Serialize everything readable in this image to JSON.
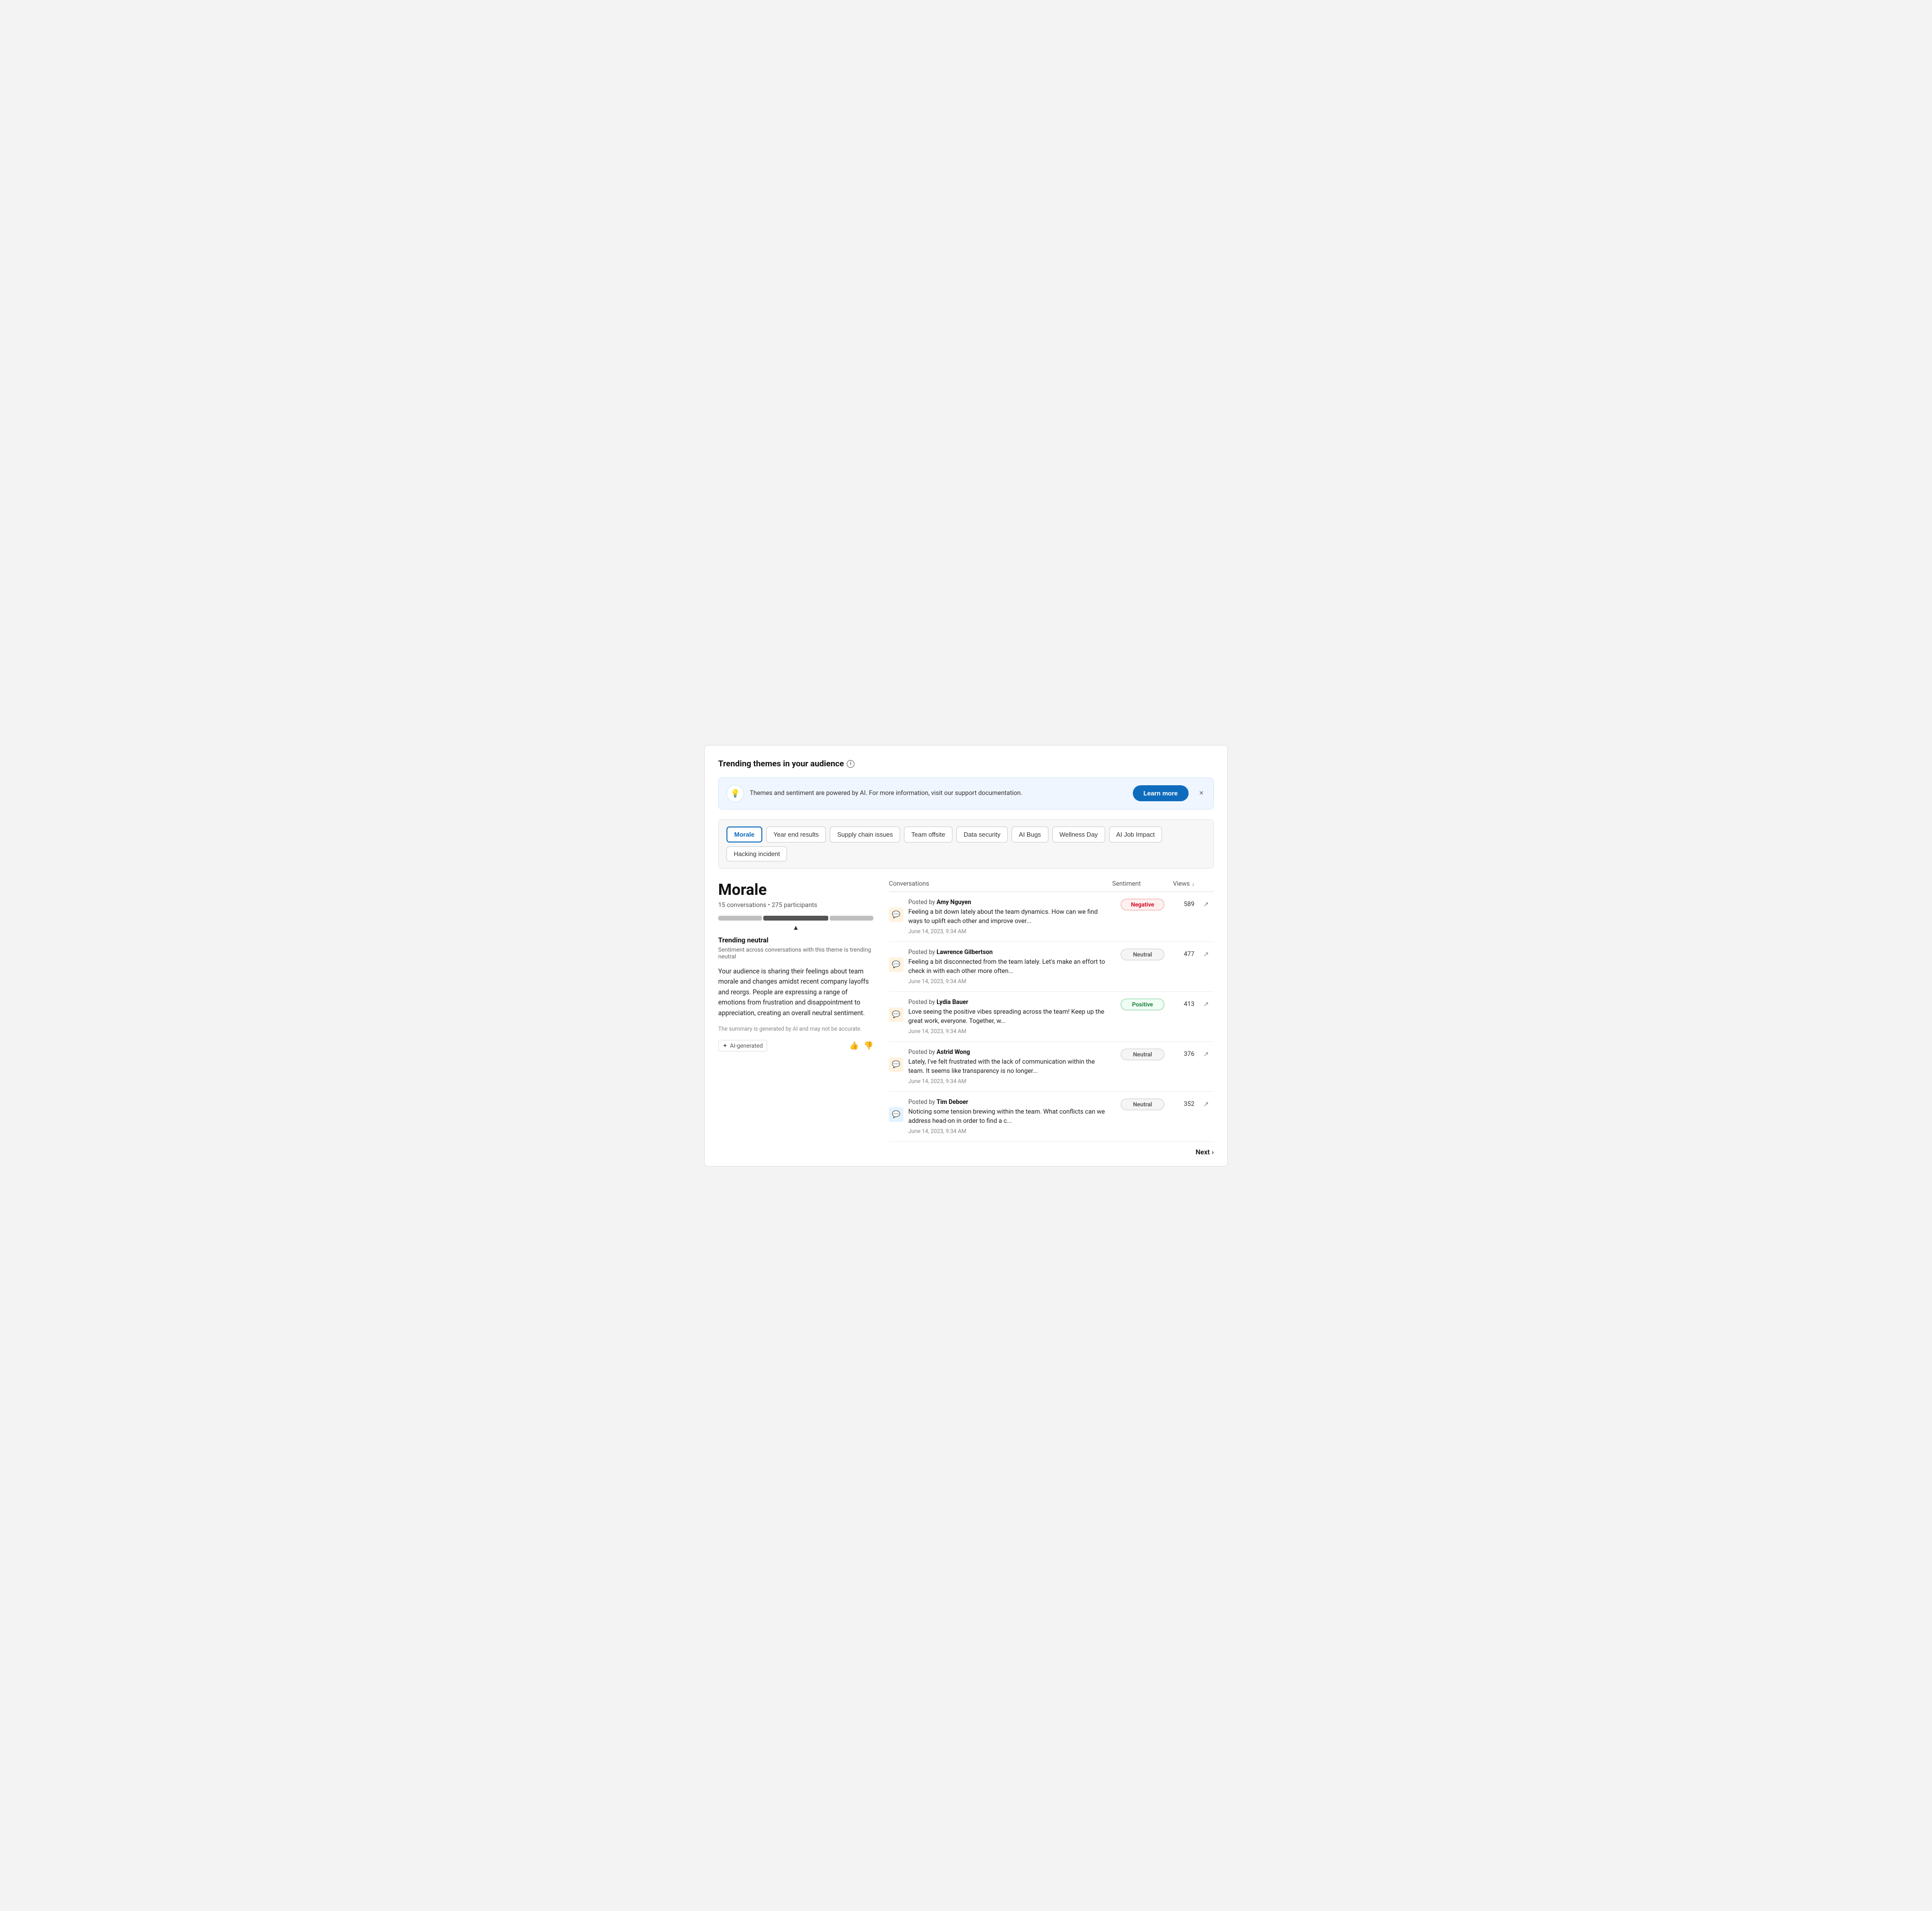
{
  "page": {
    "title": "Trending themes in your audience"
  },
  "banner": {
    "icon": "💡",
    "text": "Themes and sentiment are powered by AI. For more information, visit our support documentation.",
    "learn_more": "Learn more",
    "close_label": "×"
  },
  "themes": [
    {
      "label": "Morale",
      "active": true
    },
    {
      "label": "Year end results",
      "active": false
    },
    {
      "label": "Supply chain issues",
      "active": false
    },
    {
      "label": "Team offsite",
      "active": false
    },
    {
      "label": "Data security",
      "active": false
    },
    {
      "label": "AI Bugs",
      "active": false
    },
    {
      "label": "Wellness Day",
      "active": false
    },
    {
      "label": "AI Job Impact",
      "active": false
    },
    {
      "label": "Hacking incident",
      "active": false
    }
  ],
  "detail": {
    "title": "Morale",
    "conversations_count": "15 conversations",
    "participants_count": "275 participants",
    "trending_label": "Trending neutral",
    "trending_sub": "Sentiment across conversations with this theme is trending neutral",
    "summary": "Your audience is sharing their feelings about team morale and changes amidst recent company layoffs and reorgs. People are expressing a range of emotions from frustration and disappointment to appreciation, creating an overall neutral sentiment.",
    "ai_disclaimer": "The summary is generated by AI and may not be accurate.",
    "ai_generated_label": "AI-generated",
    "thumbs_up": "👍",
    "thumbs_down": "👎"
  },
  "table": {
    "col_conversations": "Conversations",
    "col_sentiment": "Sentiment",
    "col_views": "Views",
    "sort_arrow": "↓"
  },
  "conversations": [
    {
      "author": "Amy Nguyen",
      "text": "Feeling a bit down lately about the team dynamics. How can we find ways to uplift each other and improve over...",
      "date": "June 14, 2023, 9:34 AM",
      "sentiment": "Negative",
      "sentiment_class": "negative",
      "views": "589",
      "icon_type": "orange",
      "icon": "💬"
    },
    {
      "author": "Lawrence Gilbertson",
      "text": "Feeling a bit disconnected from the team lately. Let's make an effort to check in with each other more often...",
      "date": "June 14, 2023, 9:34 AM",
      "sentiment": "Neutral",
      "sentiment_class": "neutral",
      "views": "477",
      "icon_type": "orange",
      "icon": "💬"
    },
    {
      "author": "Lydia Bauer",
      "text": "Love seeing the positive vibes spreading across the team! Keep up the great work, everyone. Together, w...",
      "date": "June 14, 2023, 9:34 AM",
      "sentiment": "Positive",
      "sentiment_class": "positive",
      "views": "413",
      "icon_type": "orange",
      "icon": "💬"
    },
    {
      "author": "Astrid Wong",
      "text": "Lately, I've felt frustrated with the lack of communication within the team. It seems like transparency is no longer...",
      "date": "June 14, 2023, 9:34 AM",
      "sentiment": "Neutral",
      "sentiment_class": "neutral",
      "views": "376",
      "icon_type": "orange",
      "icon": "💬"
    },
    {
      "author": "Tim Deboer",
      "text": "Noticing some tension brewing within the team. What conflicts can we address head-on in order to find a c...",
      "date": "June 14, 2023, 9:34 AM",
      "sentiment": "Neutral",
      "sentiment_class": "neutral",
      "views": "352",
      "icon_type": "blue",
      "icon": "💬"
    }
  ],
  "pagination": {
    "next_label": "Next"
  }
}
